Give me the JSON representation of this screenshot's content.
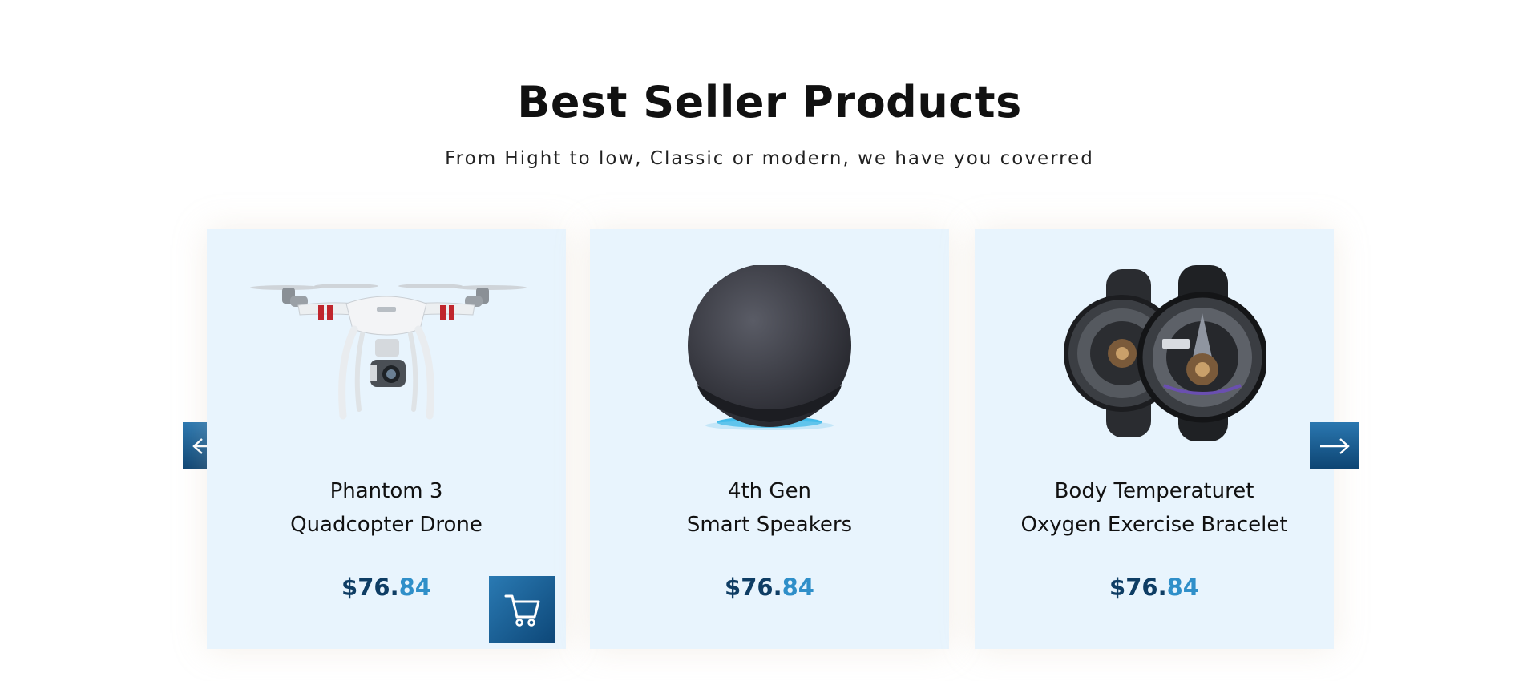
{
  "section": {
    "title": "Best Seller Products",
    "subtitle": "From Hight to low, Classic or modern, we have you coverred"
  },
  "carousel": {
    "prev_icon": "arrow-left-icon",
    "next_icon": "arrow-right-icon",
    "products": [
      {
        "name_line1": "Phantom 3",
        "name_line2": "Quadcopter Drone",
        "price_main": "$76.",
        "price_cents": "84",
        "image": "drone-image",
        "cart_icon": "cart-icon"
      },
      {
        "name_line1": "4th Gen",
        "name_line2": "Smart Speakers",
        "price_main": "$76.",
        "price_cents": "84",
        "image": "smart-speaker-image"
      },
      {
        "name_line1": "Body Temperaturet",
        "name_line2": "Oxygen Exercise Bracelet",
        "price_main": "$76.",
        "price_cents": "84",
        "image": "smartwatch-image"
      }
    ]
  },
  "colors": {
    "card_background": "#e8f4fd",
    "price_dark": "#0e3d64",
    "price_accent": "#2f8fc9",
    "button_gradient_top": "#2a7ab3",
    "button_gradient_bottom": "#0d4778"
  }
}
